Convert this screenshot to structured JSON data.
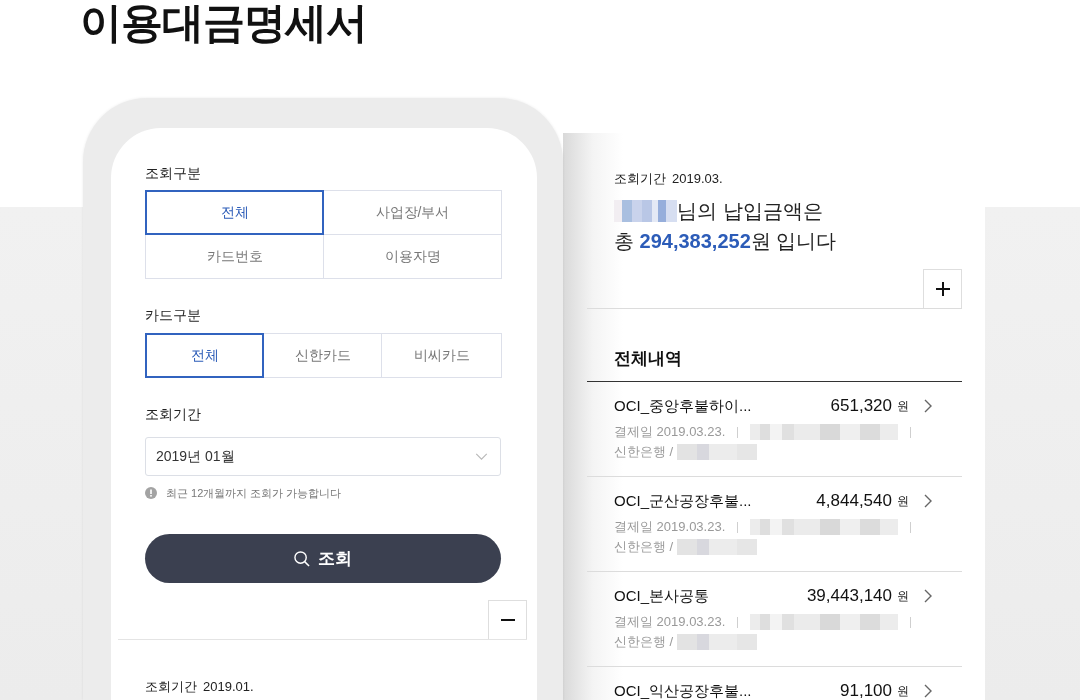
{
  "page": {
    "title": "이용대금명세서"
  },
  "query_form": {
    "query_type": {
      "label": "조회구분",
      "options": [
        {
          "label": "전체",
          "selected": true
        },
        {
          "label": "사업장/부서",
          "selected": false
        },
        {
          "label": "카드번호",
          "selected": false
        },
        {
          "label": "이용자명",
          "selected": false
        }
      ]
    },
    "card_type": {
      "label": "카드구분",
      "options": [
        {
          "label": "전체",
          "selected": true
        },
        {
          "label": "신한카드",
          "selected": false
        },
        {
          "label": "비씨카드",
          "selected": false
        }
      ]
    },
    "period": {
      "label": "조회기간",
      "value": "2019년 01월",
      "hint": "최근 12개월까지 조회가 가능합니다"
    },
    "search_button": {
      "label": "조회"
    },
    "result_period": {
      "label": "조회기간",
      "value": "2019.01."
    }
  },
  "statement": {
    "period": {
      "label": "조회기간",
      "value": "2019.03."
    },
    "greeting": "님의 납입금액은",
    "total": "총 **294,383,252**원 입니다",
    "section_title": "전체내역",
    "items": [
      {
        "name": "OCI_중앙후불하이...",
        "amount": "651,320",
        "unit": "원",
        "date": "결제일 2019.03.23.",
        "bank": "신한은행 /"
      },
      {
        "name": "OCI_군산공장후불...",
        "amount": "4,844,540",
        "unit": "원",
        "date": "결제일 2019.03.23.",
        "bank": "신한은행 /"
      },
      {
        "name": "OCI_본사공통",
        "amount": "39,443,140",
        "unit": "원",
        "date": "결제일 2019.03.23.",
        "bank": "신한은행 /"
      },
      {
        "name": "OCI_익산공장후불...",
        "amount": "91,100",
        "unit": "원"
      }
    ]
  }
}
